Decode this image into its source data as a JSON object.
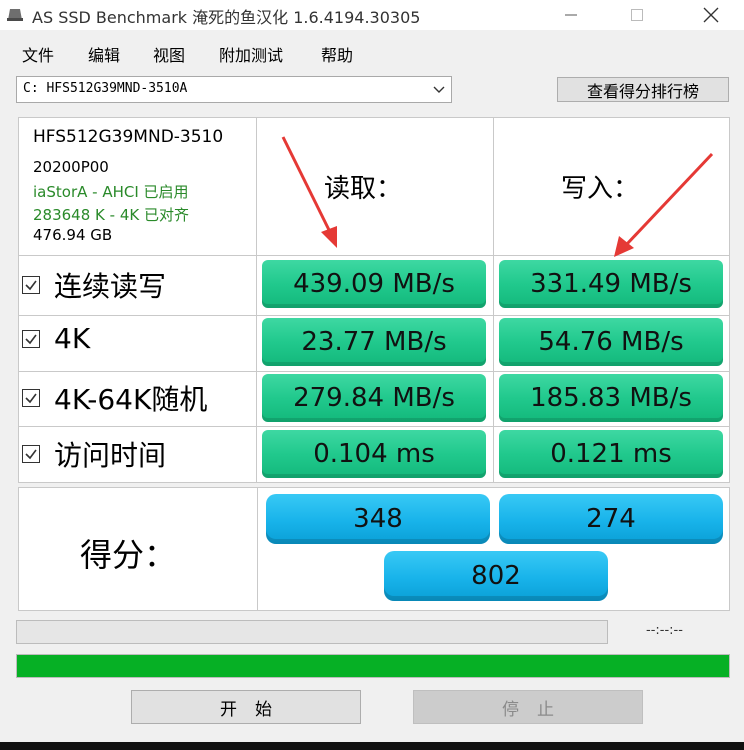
{
  "window": {
    "title": "AS SSD Benchmark 淹死的鱼汉化 1.6.4194.30305",
    "controls": {
      "minimize": "—",
      "maximize": "☐",
      "close": "✕"
    }
  },
  "menu": [
    "文件",
    "编辑",
    "视图",
    "附加测试",
    "帮助"
  ],
  "drive": {
    "selected": "C: HFS512G39MND-3510A",
    "rank_button": "查看得分排行榜"
  },
  "info": {
    "model": "HFS512G39MND-3510",
    "firmware": "20200P00",
    "driver": "iaStorA - AHCI 已启用",
    "alignment": "283648 K - 4K 已对齐",
    "capacity": "476.94 GB"
  },
  "columns": {
    "read": "读取：",
    "write": "写入："
  },
  "rows": [
    {
      "label": "连续读写",
      "read": "439.09 MB/s",
      "write": "331.49 MB/s"
    },
    {
      "label": "4K",
      "read": "23.77 MB/s",
      "write": "54.76 MB/s"
    },
    {
      "label": "4K-64K随机",
      "read": "279.84 MB/s",
      "write": "185.83 MB/s"
    },
    {
      "label": "访问时间",
      "read": "0.104 ms",
      "write": "0.121 ms"
    }
  ],
  "score": {
    "label": "得分：",
    "read": "348",
    "write": "274",
    "total": "802"
  },
  "progress": {
    "time": "--:--:--",
    "overall_fraction": 1.0
  },
  "buttons": {
    "start": "开始",
    "stop": "停止"
  },
  "colors": {
    "result_green": "#21c98d",
    "score_blue": "#18b3ea",
    "progress_green": "#06b025",
    "alignment_green": "#2a8a2a",
    "arrow_red": "#e53935"
  }
}
